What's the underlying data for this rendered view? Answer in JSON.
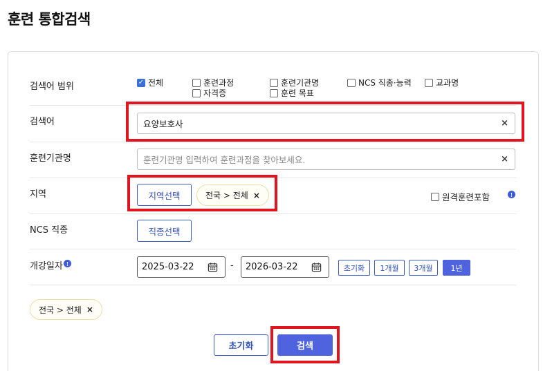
{
  "page": {
    "title": "훈련 통합검색"
  },
  "scope": {
    "label": "검색어 범위",
    "options": [
      {
        "label": "전체",
        "checked": true
      },
      {
        "label": "훈련과정",
        "checked": false
      },
      {
        "label": "훈련기관명",
        "checked": false
      },
      {
        "label": "NCS 직종·능력",
        "checked": false
      },
      {
        "label": "교과명",
        "checked": false
      },
      {
        "label": "자격증",
        "checked": false
      },
      {
        "label": "훈련 목표",
        "checked": false
      }
    ]
  },
  "keyword": {
    "label": "검색어",
    "value": "요양보호사",
    "clear": "×"
  },
  "institution": {
    "label": "훈련기관명",
    "placeholder": "훈련기관명 입력하여 훈련과정을 찾아보세요.",
    "clear": "×"
  },
  "region": {
    "label": "지역",
    "select_button": "지역선택",
    "chip": "전국 > 전체",
    "chip_remove": "×",
    "remote_label": "원격훈련포함",
    "info": "!"
  },
  "ncs": {
    "label": "NCS 직종",
    "select_button": "직종선택"
  },
  "period": {
    "label": "개강일자",
    "info": "!",
    "start": "2025-03-22",
    "separator": "-",
    "end": "2026-03-22",
    "buttons": [
      {
        "label": "초기화",
        "active": false
      },
      {
        "label": "1개월",
        "active": false
      },
      {
        "label": "3개월",
        "active": false
      },
      {
        "label": "1년",
        "active": true
      }
    ]
  },
  "selected": {
    "chip": "전국 > 전체",
    "remove": "×"
  },
  "actions": {
    "reset": "초기화",
    "search": "검색"
  },
  "colors": {
    "primary": "#4e63dd",
    "highlight": "#e0151f",
    "chip_border": "#e8e1a8"
  }
}
